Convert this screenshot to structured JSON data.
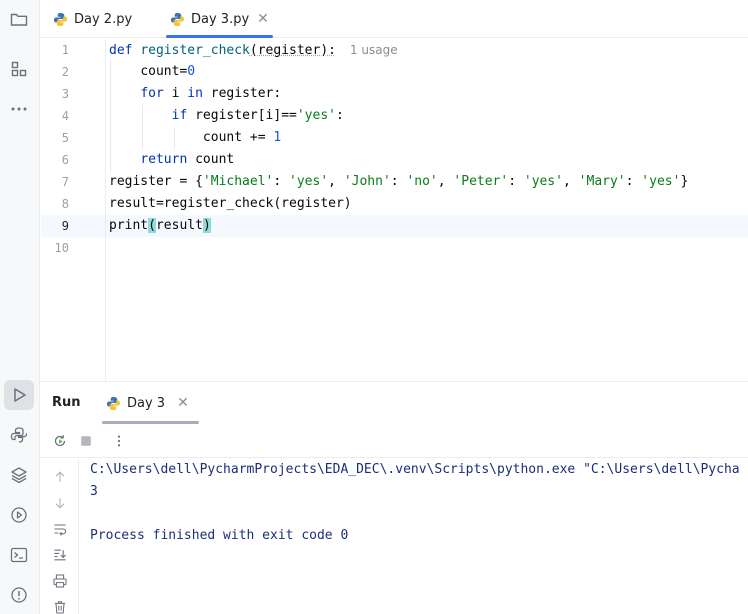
{
  "tabs": [
    {
      "label": "Day 2.py"
    },
    {
      "label": "Day 3.py"
    }
  ],
  "editor": {
    "line_numbers": [
      "1",
      "2",
      "3",
      "4",
      "5",
      "6",
      "7",
      "8",
      "9",
      "10"
    ],
    "current_line": "9",
    "usage_hint": "1 usage",
    "code": {
      "l1_kw": "def",
      "l1_fn": "register_check",
      "l1_rest": "(register):",
      "l2": "count=",
      "l2_num": "0",
      "l3_kw1": "for",
      "l3_mid": " i ",
      "l3_kw2": "in",
      "l3_rest": " register:",
      "l4_kw": "if",
      "l4_rest": " register[i]==",
      "l4_str": "'yes'",
      "l4_colon": ":",
      "l5": "count += ",
      "l5_num": "1",
      "l6_kw": "return",
      "l6_rest": " count",
      "l7_pre": "register = {",
      "l7_k1": "'Michael'",
      "l7_v1": "'yes'",
      "l7_k2": "'John'",
      "l7_v2": "'no'",
      "l7_k3": "'Peter'",
      "l7_v3": "'yes'",
      "l7_k4": "'Mary'",
      "l7_v4": "'yes'",
      "l7_colon": ": ",
      "l7_comma": ", ",
      "l7_end": "}",
      "l8": "result=register_check(register)",
      "l9_fn": "print",
      "l9_open": "(",
      "l9_arg": "result",
      "l9_close": ")"
    }
  },
  "run_panel": {
    "title": "Run",
    "tab_label": "Day 3",
    "console_lines": [
      "C:\\Users\\dell\\PycharmProjects\\EDA_DEC\\.venv\\Scripts\\python.exe \"C:\\Users\\dell\\Pycha",
      "3",
      "",
      "Process finished with exit code 0"
    ]
  },
  "icons": {
    "left_strip": [
      "folder-icon",
      "structure-icon",
      "more-icon",
      "run-icon",
      "python-console-icon",
      "layers-icon",
      "services-icon",
      "terminal-icon",
      "problems-icon"
    ],
    "run_toolbar": [
      "rerun-icon",
      "stop-icon",
      "more-vertical-icon"
    ],
    "console_gutter": [
      "up-arrow-icon",
      "down-arrow-icon",
      "soft-wrap-icon",
      "scroll-to-end-icon",
      "print-icon",
      "trash-icon"
    ]
  },
  "colors": {
    "keyword": "#0033b3",
    "string": "#067d17",
    "number": "#1750eb",
    "accent": "#3574f0",
    "console_text": "#1a2f7a"
  }
}
